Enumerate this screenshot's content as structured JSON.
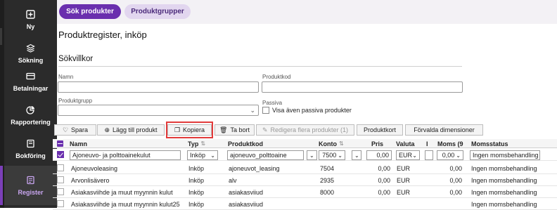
{
  "nav": {
    "items": [
      {
        "label": "Ny",
        "icon": "plus-square-icon"
      },
      {
        "label": "Sökning",
        "icon": "stack-icon"
      },
      {
        "label": "Betalningar",
        "icon": "card-icon"
      },
      {
        "label": "Rapportering",
        "icon": "pie-icon"
      },
      {
        "label": "Bokföring",
        "icon": "book-icon"
      },
      {
        "label": "Register",
        "icon": "register-icon"
      }
    ]
  },
  "tabs": {
    "search": "Sök produkter",
    "groups": "Produktgrupper"
  },
  "page": {
    "title": "Produktregister, inköp",
    "section": "Sökvillkor"
  },
  "form": {
    "name_label": "Namn",
    "code_label": "Produktkod",
    "group_label": "Produktgrupp",
    "passive_label": "Passiva",
    "passive_check": "Visa även passiva produkter"
  },
  "toolbar": {
    "save": "Spara",
    "add": "Lägg till produkt",
    "copy": "Kopiera",
    "delete": "Ta bort",
    "edit_multi": "Redigera flera produkter (1)",
    "product_card": "Produktkort",
    "default_dims": "Förvalda dimensioner"
  },
  "table": {
    "headers": {
      "name": "Namn",
      "type": "Typ",
      "code": "Produktkod",
      "account": "Konto",
      "price": "Pris",
      "currency": "Valuta",
      "i": "I",
      "vat": "Moms (9",
      "vat_status": "Momsstatus"
    },
    "filter_row": {
      "name": "Ajoneuvo- ja polttoainekulut",
      "type": "Inköp",
      "code": "ajoneuvo_polttoaine",
      "account": "7500",
      "price": "0,00",
      "currency": "EUR",
      "vat": "0,00",
      "vat_status": "Ingen momsbehandling"
    },
    "rows": [
      {
        "name": "Ajoneuvoleasing",
        "type": "Inköp",
        "code": "ajoneuvot_leasing",
        "account": "7504",
        "price": "0,00",
        "currency": "EUR",
        "vat": "0,00",
        "vat_status": "Ingen momsbehandling"
      },
      {
        "name": "Arvonlisävero",
        "type": "Inköp",
        "code": "alv",
        "account": "2935",
        "price": "0,00",
        "currency": "EUR",
        "vat": "0,00",
        "vat_status": "Ingen momsbehandling"
      },
      {
        "name": "Asiakasviihde ja muut myynnin kulut",
        "type": "Inköp",
        "code": "asiakasviiud",
        "account": "8000",
        "price": "0,00",
        "currency": "EUR",
        "vat": "0,00",
        "vat_status": "Ingen momsbehandling"
      },
      {
        "name": "Asiakasviihde ja muut myynnin kulut25",
        "type": "Inköp",
        "code": "asiakasviiud",
        "account": "",
        "price": "",
        "currency": "",
        "vat": "",
        "vat_status": "Ingen momsbehandling"
      }
    ]
  },
  "colors": {
    "accent": "#6a2fae",
    "nav_bg": "#2b2b2b",
    "highlight": "#e23b3b"
  }
}
